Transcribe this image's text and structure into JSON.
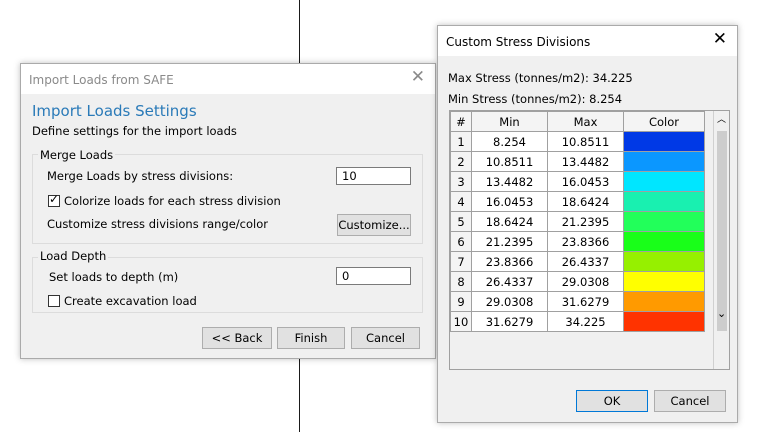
{
  "import_dialog": {
    "window_title": "Import Loads from SAFE",
    "heading": "Import Loads Settings",
    "subheading": "Define settings for the import loads",
    "merge_group": {
      "caption": "Merge Loads",
      "merge_label": "Merge Loads by stress divisions:",
      "merge_value": "10",
      "colorize_label": "Colorize loads for each stress division",
      "colorize_checked": true,
      "customize_label": "Customize stress divisions range/color",
      "customize_button": "Customize..."
    },
    "depth_group": {
      "caption": "Load Depth",
      "depth_label": "Set loads to depth (m)",
      "depth_value": "0",
      "excavation_label": "Create excavation load",
      "excavation_checked": false
    },
    "buttons": {
      "back": "<< Back",
      "finish": "Finish",
      "cancel": "Cancel"
    }
  },
  "stress_dialog": {
    "window_title": "Custom Stress Divisions",
    "max_stress": "Max Stress (tonnes/m2): 34.225",
    "min_stress": "Min Stress (tonnes/m2): 8.254",
    "table": {
      "headers": [
        "#",
        "Min",
        "Max",
        "Color"
      ],
      "rows": [
        {
          "n": "1",
          "min": "8.254",
          "max": "10.8511",
          "color": "#0039e6"
        },
        {
          "n": "2",
          "min": "10.8511",
          "max": "13.4482",
          "color": "#0b97ff"
        },
        {
          "n": "3",
          "min": "13.4482",
          "max": "16.0453",
          "color": "#00e6ff"
        },
        {
          "n": "4",
          "min": "16.0453",
          "max": "18.6424",
          "color": "#19f0b0"
        },
        {
          "n": "5",
          "min": "18.6424",
          "max": "21.2395",
          "color": "#22ff5a"
        },
        {
          "n": "6",
          "min": "21.2395",
          "max": "23.8366",
          "color": "#19ff19"
        },
        {
          "n": "7",
          "min": "23.8366",
          "max": "26.4337",
          "color": "#96f000"
        },
        {
          "n": "8",
          "min": "26.4337",
          "max": "29.0308",
          "color": "#ffff00"
        },
        {
          "n": "9",
          "min": "29.0308",
          "max": "31.6279",
          "color": "#ff9a00"
        },
        {
          "n": "10",
          "min": "31.6279",
          "max": "34.225",
          "color": "#ff3300"
        }
      ]
    },
    "buttons": {
      "ok": "OK",
      "cancel": "Cancel"
    }
  },
  "icons": {
    "close": "close-icon",
    "check": "check-icon",
    "scroll_up": "chevron-up-icon",
    "scroll_down": "chevron-down-icon"
  }
}
